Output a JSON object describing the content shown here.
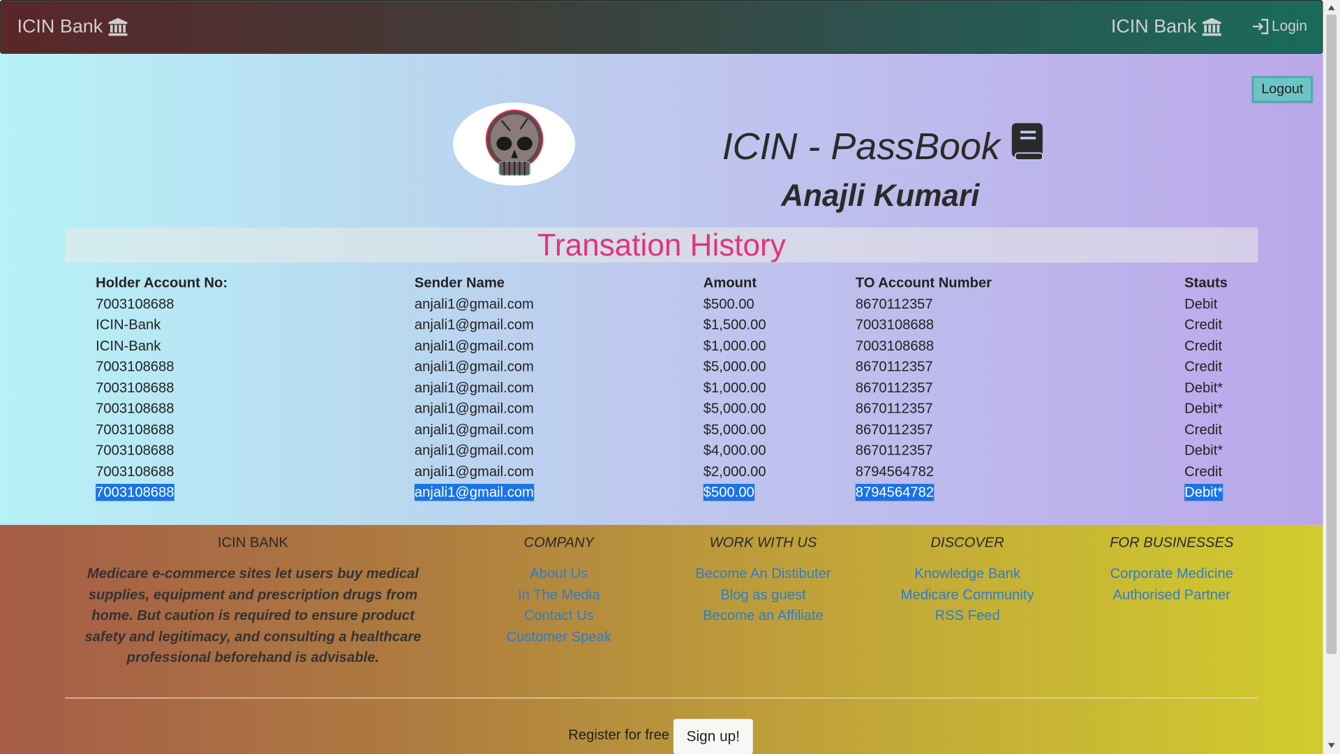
{
  "navbar": {
    "brand_left": "ICIN Bank",
    "brand_right": "ICIN Bank",
    "login_label": "Login"
  },
  "logout_label": "Logout",
  "passbook": {
    "title": "ICIN - PassBook",
    "holder_name": "Anajli Kumari",
    "history_title": "Transation History"
  },
  "table": {
    "headers": [
      "Holder Account No:",
      "Sender Name",
      "Amount",
      "TO Account Number",
      "Stauts"
    ],
    "rows": [
      [
        "7003108688",
        "anjali1@gmail.com",
        "$500.00",
        "8670112357",
        "Debit"
      ],
      [
        "ICIN-Bank",
        "anjali1@gmail.com",
        "$1,500.00",
        "7003108688",
        "Credit"
      ],
      [
        "ICIN-Bank",
        "anjali1@gmail.com",
        "$1,000.00",
        "7003108688",
        "Credit"
      ],
      [
        "7003108688",
        "anjali1@gmail.com",
        "$5,000.00",
        "8670112357",
        "Credit"
      ],
      [
        "7003108688",
        "anjali1@gmail.com",
        "$1,000.00",
        "8670112357",
        "Debit*"
      ],
      [
        "7003108688",
        "anjali1@gmail.com",
        "$5,000.00",
        "8670112357",
        "Debit*"
      ],
      [
        "7003108688",
        "anjali1@gmail.com",
        "$5,000.00",
        "8670112357",
        "Credit"
      ],
      [
        "7003108688",
        "anjali1@gmail.com",
        "$4,000.00",
        "8670112357",
        "Debit*"
      ],
      [
        "7003108688",
        "anjali1@gmail.com",
        "$2,000.00",
        "8794564782",
        "Credit"
      ],
      [
        "7003108688",
        "anjali1@gmail.com",
        "$500.00",
        "8794564782",
        "Debit*"
      ]
    ]
  },
  "footer": {
    "bank_heading": "ICIN BANK",
    "bank_about": "Medicare e-commerce sites let users buy medical supplies, equipment and prescription drugs from home. But caution is required to ensure product safety and legitimacy, and consulting a healthcare professional beforehand is advisable.",
    "company": {
      "heading": "COMPANY",
      "links": [
        "About Us",
        "In The Media",
        "Contact Us",
        "Customer Speak"
      ]
    },
    "work": {
      "heading": "WORK WITH US",
      "links": [
        "Become An Distibuter",
        "Blog as guest",
        "Become an Affiliate"
      ]
    },
    "discover": {
      "heading": "DISCOVER",
      "links": [
        "Knowledge Bank",
        "Medicare Community",
        "RSS Feed"
      ]
    },
    "business": {
      "heading": "FOR BUSINESSES",
      "links": [
        "Corporate Medicine",
        "Authorised Partner"
      ]
    },
    "register_text": "Register for free",
    "signup_label": "Sign up!"
  },
  "colors": {
    "history_title": "#e0357a",
    "link": "#2d7dc8",
    "selection": "#1a73e8",
    "logout_button": "#6ec4c4"
  }
}
